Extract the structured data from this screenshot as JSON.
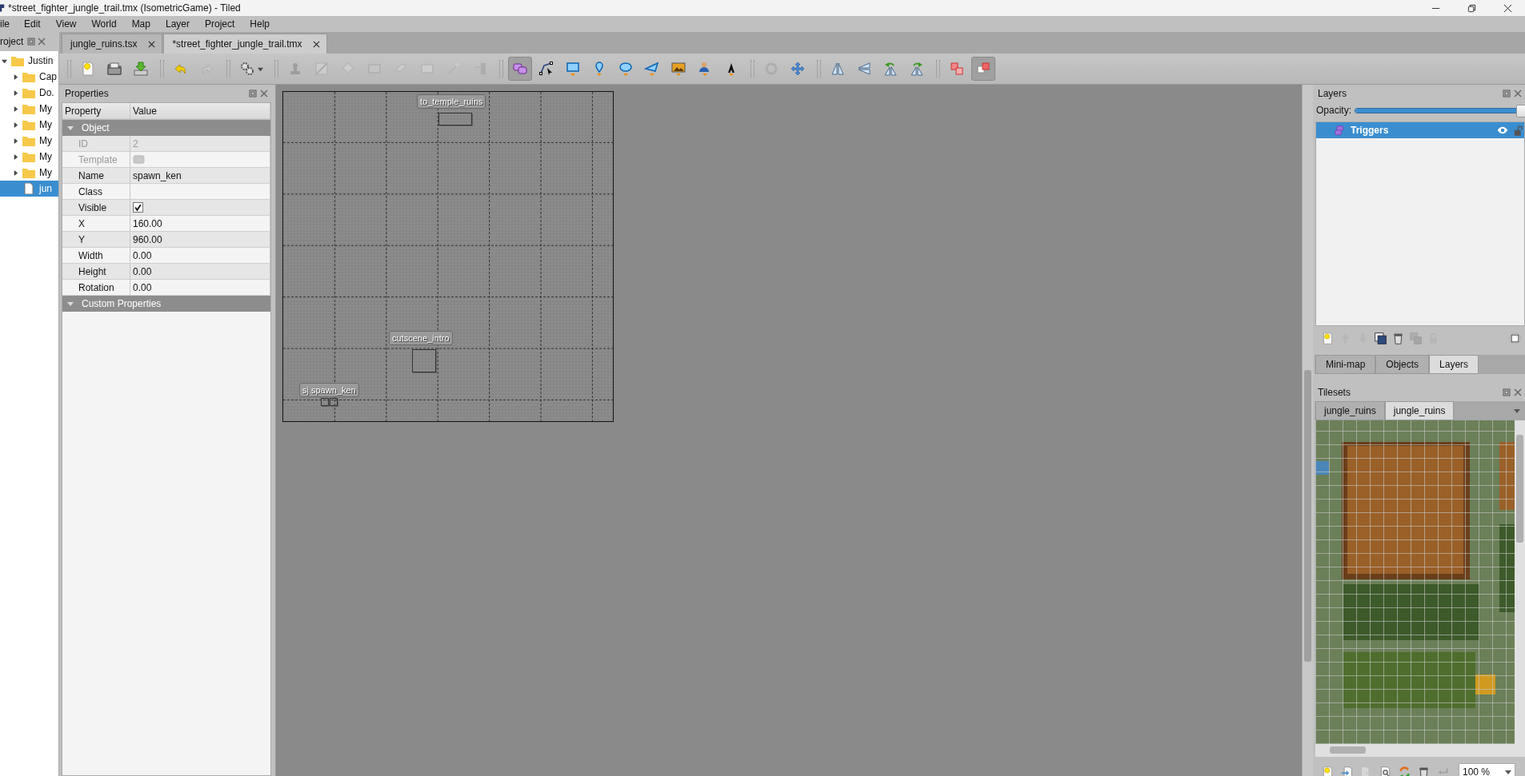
{
  "window": {
    "title": "*street_fighter_jungle_trail.tmx (IsometricGame) - Tiled"
  },
  "menu": [
    "ile",
    "Edit",
    "View",
    "World",
    "Map",
    "Layer",
    "Project",
    "Help"
  ],
  "project_panel": {
    "title": "roject",
    "tree": [
      {
        "label": "Justin",
        "kind": "folder",
        "expanded": true,
        "selected": false,
        "children": [
          {
            "label": "Cap",
            "kind": "folder",
            "expanded": false,
            "selected": false
          },
          {
            "label": "Do.",
            "kind": "folder",
            "expanded": false,
            "selected": false
          },
          {
            "label": "My",
            "kind": "folder",
            "expanded": false,
            "selected": false
          },
          {
            "label": "My",
            "kind": "folder",
            "expanded": false,
            "selected": false
          },
          {
            "label": "My",
            "kind": "folder",
            "expanded": false,
            "selected": false
          },
          {
            "label": "My",
            "kind": "folder",
            "expanded": false,
            "selected": false
          },
          {
            "label": "My",
            "kind": "folder",
            "expanded": false,
            "selected": false
          },
          {
            "label": "jun",
            "kind": "file",
            "selected": true
          }
        ]
      }
    ]
  },
  "tabs": [
    {
      "label": "jungle_ruins.tsx",
      "selected": false
    },
    {
      "label": "*street_fighter_jungle_trail.tmx",
      "selected": true
    }
  ],
  "toolbar": {
    "groups": [
      [
        {
          "kind": "new",
          "selected": false,
          "disabled": false
        },
        {
          "kind": "open",
          "selected": false,
          "disabled": false
        },
        {
          "kind": "save",
          "selected": false,
          "disabled": false
        }
      ],
      [
        {
          "kind": "undo",
          "selected": false,
          "disabled": false
        },
        {
          "kind": "redo",
          "selected": false,
          "disabled": true
        }
      ],
      [
        {
          "kind": "gears",
          "selected": false,
          "disabled": false
        }
      ],
      [
        {
          "kind": "stamp",
          "selected": false,
          "disabled": true
        },
        {
          "kind": "terrain",
          "selected": false,
          "disabled": true
        },
        {
          "kind": "bucket",
          "selected": false,
          "disabled": true
        },
        {
          "kind": "rectfill",
          "selected": false,
          "disabled": true
        },
        {
          "kind": "eraser",
          "selected": false,
          "disabled": true
        },
        {
          "kind": "selectrect",
          "selected": false,
          "disabled": true
        },
        {
          "kind": "wand",
          "selected": false,
          "disabled": true
        },
        {
          "kind": "same",
          "selected": false,
          "disabled": true
        }
      ],
      [
        {
          "kind": "selobj",
          "selected": true,
          "disabled": false
        },
        {
          "kind": "editpoly",
          "selected": false,
          "disabled": false
        },
        {
          "kind": "rect",
          "selected": false,
          "disabled": false
        },
        {
          "kind": "point",
          "selected": false,
          "disabled": false
        },
        {
          "kind": "ellipse",
          "selected": false,
          "disabled": false
        },
        {
          "kind": "polygon",
          "selected": false,
          "disabled": false
        },
        {
          "kind": "tile",
          "selected": false,
          "disabled": false
        },
        {
          "kind": "template",
          "selected": false,
          "disabled": false
        },
        {
          "kind": "text",
          "selected": false,
          "disabled": false
        }
      ],
      [
        {
          "kind": "rotate",
          "selected": false,
          "disabled": true
        },
        {
          "kind": "move",
          "selected": false,
          "disabled": false
        }
      ],
      [
        {
          "kind": "fliph",
          "selected": false,
          "disabled": false
        },
        {
          "kind": "flipv",
          "selected": false,
          "disabled": false
        },
        {
          "kind": "rotl",
          "selected": false,
          "disabled": false
        },
        {
          "kind": "rotr",
          "selected": false,
          "disabled": false
        }
      ],
      [
        {
          "kind": "random",
          "selected": false,
          "disabled": false
        },
        {
          "kind": "toggle",
          "selected": true,
          "disabled": false
        }
      ]
    ]
  },
  "properties": {
    "title": "Properties",
    "columns": [
      "Property",
      "Value"
    ],
    "groups": [
      {
        "label": "Object",
        "expanded": true,
        "rows": [
          {
            "property": "ID",
            "value": "2",
            "kind": "text",
            "disabled": true
          },
          {
            "property": "Template",
            "kind": "template",
            "disabled": true
          },
          {
            "property": "Name",
            "value": "spawn_ken",
            "kind": "text",
            "disabled": false
          },
          {
            "property": "Class",
            "kind": "text",
            "disabled": false
          },
          {
            "property": "Visible",
            "kind": "check",
            "checked": true,
            "disabled": false
          },
          {
            "property": "X",
            "value": "160.00",
            "kind": "text",
            "disabled": false
          },
          {
            "property": "Y",
            "value": "960.00",
            "kind": "text",
            "disabled": false
          },
          {
            "property": "Width",
            "value": "0.00",
            "kind": "text",
            "disabled": false
          },
          {
            "property": "Height",
            "value": "0.00",
            "kind": "text",
            "disabled": false
          },
          {
            "property": "Rotation",
            "value": "0.00",
            "kind": "text",
            "disabled": false
          }
        ]
      },
      {
        "label": "Custom Properties",
        "expanded": true
      }
    ]
  },
  "map": {
    "objects": [
      {
        "name": "to_temple_ruins",
        "kind": "rect"
      },
      {
        "name": "cutscene_intro",
        "kind": "rect"
      },
      {
        "name": "sj spawn_ken",
        "kind": "pair"
      }
    ]
  },
  "layers_panel": {
    "title": "Layers",
    "opacity_label": "Opacity:",
    "opacity": {
      "level": 1
    },
    "layers": [
      {
        "name": "Triggers",
        "selected": true,
        "visible": true,
        "locked": false
      }
    ],
    "tools": [
      {
        "kind": "new",
        "disabled": false
      },
      {
        "kind": "up",
        "disabled": true
      },
      {
        "kind": "down",
        "disabled": true
      },
      {
        "kind": "dup",
        "disabled": false
      },
      {
        "kind": "trash",
        "disabled": false
      },
      {
        "kind": "merge",
        "disabled": true
      },
      {
        "kind": "lock",
        "disabled": true
      },
      {
        "kind": "highlight",
        "disabled": false
      }
    ],
    "tabs": [
      {
        "label": "Mini-map",
        "selected": false
      },
      {
        "label": "Objects",
        "selected": false
      },
      {
        "label": "Layers",
        "selected": true
      }
    ]
  },
  "tilesets_panel": {
    "title": "Tilesets",
    "tabs": [
      {
        "label": "jungle_ruins",
        "selected": false
      },
      {
        "label": "jungle_ruins",
        "selected": true
      }
    ],
    "tools": [
      {
        "kind": "new",
        "disabled": false
      },
      {
        "kind": "import",
        "disabled": false
      },
      {
        "kind": "export",
        "disabled": true
      },
      {
        "kind": "edit",
        "disabled": false
      },
      {
        "kind": "swap",
        "disabled": false
      },
      {
        "kind": "trash",
        "disabled": false
      },
      {
        "kind": "back",
        "disabled": true
      }
    ],
    "zoom": "100 %"
  }
}
